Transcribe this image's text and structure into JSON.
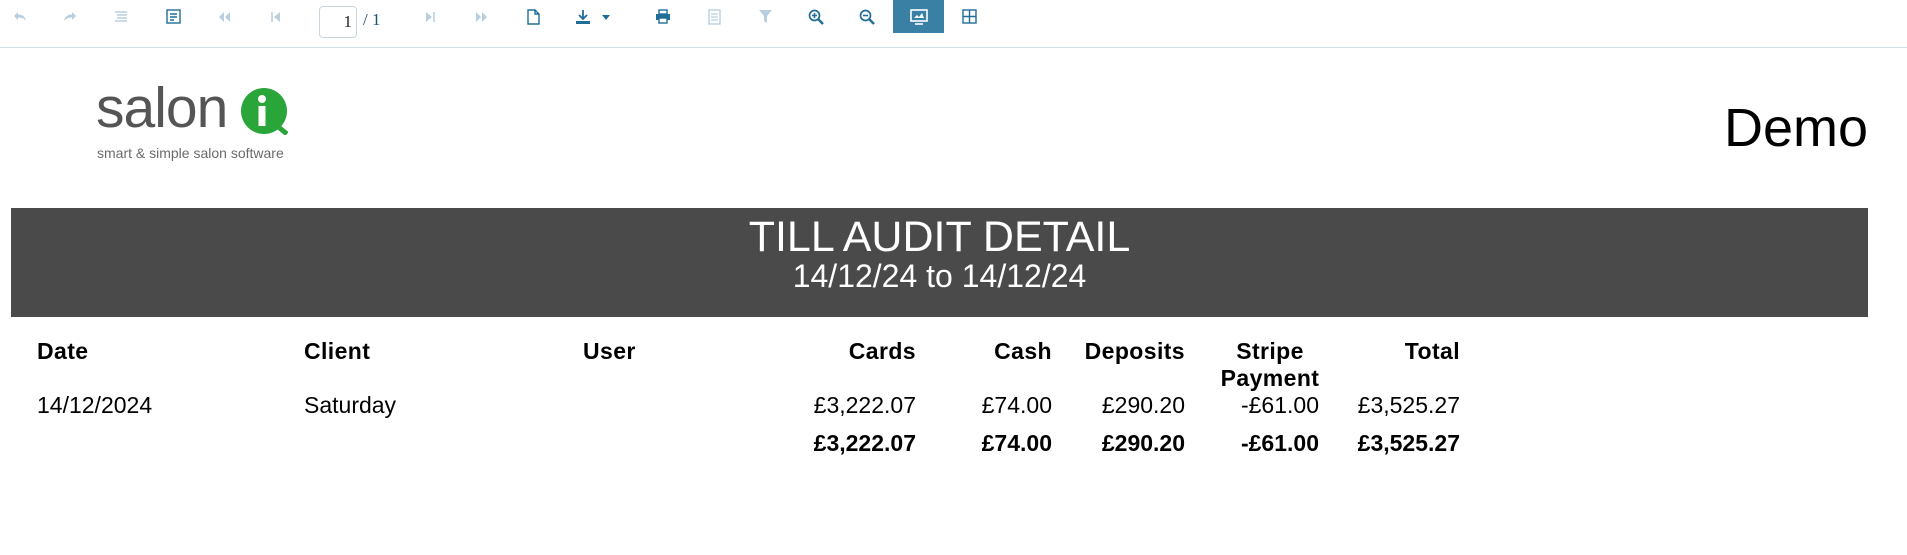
{
  "toolbar": {
    "current_page": "1",
    "page_total": "/ 1",
    "buttons": [
      {
        "name": "undo-icon"
      },
      {
        "name": "redo-icon"
      },
      {
        "name": "document-map-icon"
      },
      {
        "name": "parameters-icon"
      },
      {
        "name": "first-page-icon"
      },
      {
        "name": "previous-page-icon"
      },
      {
        "name": "next-page-icon"
      },
      {
        "name": "last-page-icon"
      },
      {
        "name": "print-layout-icon"
      },
      {
        "name": "export-icon"
      },
      {
        "name": "print-icon"
      },
      {
        "name": "page-setup-icon"
      },
      {
        "name": "filter-icon"
      },
      {
        "name": "zoom-in-icon"
      },
      {
        "name": "zoom-out-icon"
      },
      {
        "name": "fullscreen-icon"
      },
      {
        "name": "multipage-icon"
      }
    ]
  },
  "report": {
    "logo_text": "salon",
    "logo_letter": "i",
    "logo_tagline": "smart & simple salon software",
    "company": "Demo",
    "title": "TILL AUDIT DETAIL",
    "date_range": "14/12/24 to 14/12/24",
    "columns": {
      "date": "Date",
      "client": "Client",
      "user": "User",
      "cards": "Cards",
      "cash": "Cash",
      "deposits": "Deposits",
      "stripe_line1": "Stripe",
      "stripe_line2": "Payment",
      "total": "Total"
    },
    "rows": [
      {
        "date": "14/12/2024",
        "client": "Saturday",
        "user": "",
        "cards": "£3,222.07",
        "cash": "£74.00",
        "deposits": "£290.20",
        "stripe": "-£61.00",
        "total": "£3,525.27"
      }
    ],
    "totals": {
      "cards": "£3,222.07",
      "cash": "£74.00",
      "deposits": "£290.20",
      "stripe": "-£61.00",
      "total": "£3,525.27"
    }
  },
  "colors": {
    "banner": "#4a4a4a",
    "logo_green": "#2aa53a",
    "toolbar_active": "#3a7fa4"
  }
}
